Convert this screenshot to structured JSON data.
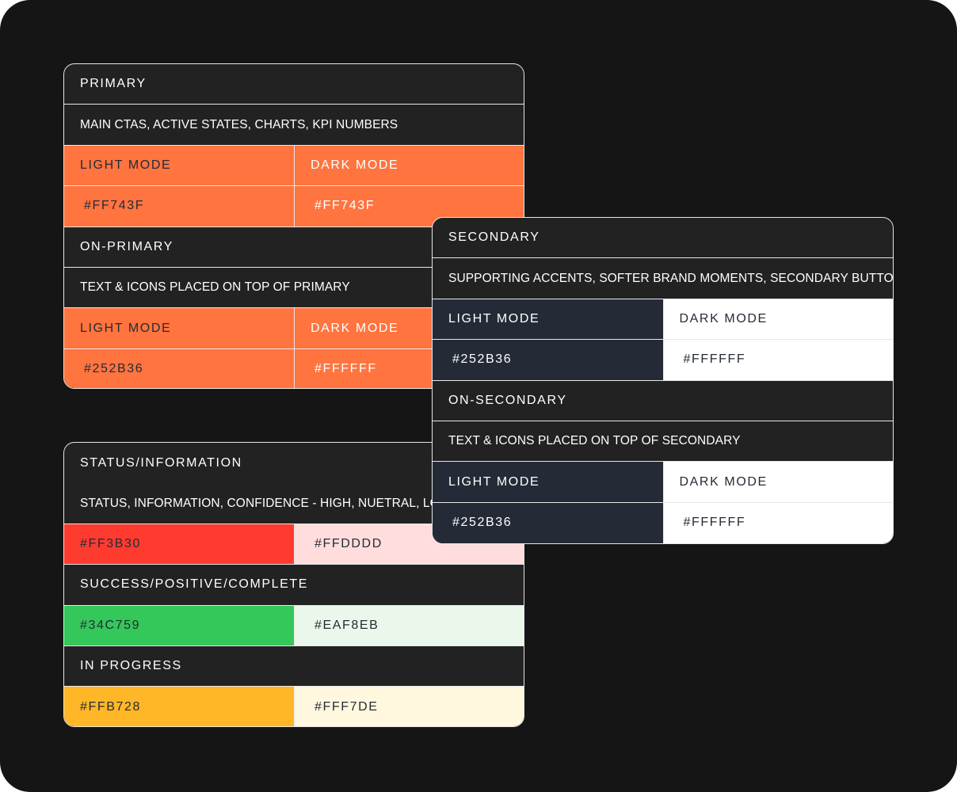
{
  "colors": {
    "frame_bg": "#151515",
    "card_bg": "#222222",
    "primary_orange": "#FF743F",
    "navy": "#252B36",
    "white": "#FFFFFF",
    "red": "#FF3B30",
    "red_light": "#FFDDDD",
    "green": "#34C759",
    "green_light": "#EAF8EB",
    "amber": "#FFB728",
    "amber_light": "#FFF7DE"
  },
  "primary": {
    "title": "PRIMARY",
    "description": "MAIN CTAS, ACTIVE STATES, CHARTS, KPI NUMBERS",
    "light_label": "LIGHT MODE",
    "dark_label": "DARK MODE",
    "light_hex": "#FF743F",
    "dark_hex": "#FF743F"
  },
  "on_primary": {
    "title": "ON-PRIMARY",
    "description": "TEXT & ICONS PLACED ON TOP OF PRIMARY",
    "light_label": "LIGHT MODE",
    "dark_label": "DARK MODE",
    "light_hex": "#252B36",
    "dark_hex": "#FFFFFF"
  },
  "secondary": {
    "title": "SECONDARY",
    "description": "SUPPORTING ACCENTS, SOFTER BRAND MOMENTS, SECONDARY BUTTONS",
    "light_label": "LIGHT MODE",
    "dark_label": "DARK MODE",
    "light_hex": "#252B36",
    "dark_hex": "#FFFFFF"
  },
  "on_secondary": {
    "title": "ON-SECONDARY",
    "description": "TEXT & ICONS PLACED ON TOP OF SECONDARY",
    "light_label": "LIGHT MODE",
    "dark_label": "DARK MODE",
    "light_hex": "#252B36",
    "dark_hex": "#FFFFFF"
  },
  "status": {
    "title": "STATUS/INFORMATION",
    "description": "STATUS, INFORMATION, CONFIDENCE - HIGH, NUETRAL, LOW",
    "error_hex": "#FF3B30",
    "error_light_hex": "#FFDDDD",
    "success_title": "SUCCESS/POSITIVE/COMPLETE",
    "success_hex": "#34C759",
    "success_light_hex": "#EAF8EB",
    "progress_title": "IN PROGRESS",
    "progress_hex": "#FFB728",
    "progress_light_hex": "#FFF7DE"
  }
}
